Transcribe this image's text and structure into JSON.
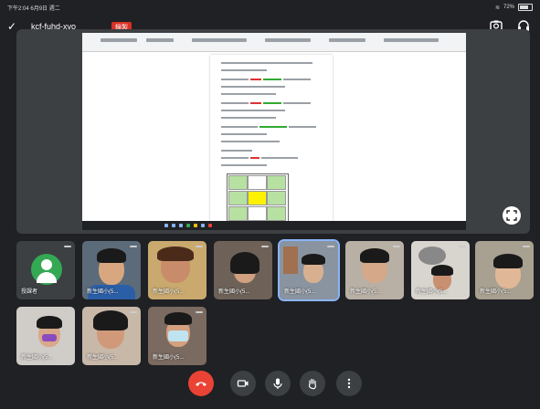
{
  "status_bar": {
    "time": "下午2:04",
    "date": "6月9日 週二",
    "battery": "72%"
  },
  "meeting": {
    "title": "kcf-fuhd-xvo",
    "recording_badge": "錄製"
  },
  "participants": [
    {
      "name": "授課者",
      "kind": "avatar"
    },
    {
      "name": "新生國小(5...",
      "kind": "video"
    },
    {
      "name": "新生國小(5...",
      "kind": "video"
    },
    {
      "name": "新生國小(5...",
      "kind": "video"
    },
    {
      "name": "新生國小(5...",
      "kind": "video",
      "active": true
    },
    {
      "name": "新生國小(5...",
      "kind": "video"
    },
    {
      "name": "新生國小(5...",
      "kind": "video"
    },
    {
      "name": "新生國小(5...",
      "kind": "video"
    },
    {
      "name": "新生國小(5...",
      "kind": "video"
    },
    {
      "name": "新生國小(5...",
      "kind": "video"
    },
    {
      "name": "新生國小(5...",
      "kind": "video"
    }
  ],
  "icons": {
    "back": "chevron-icon",
    "camera_switch": "camera-icon",
    "audio_output": "headphones-icon",
    "fullscreen": "fullscreen-icon",
    "end_call": "end-call-icon",
    "video": "video-icon",
    "mic": "mic-icon",
    "raise_hand": "hand-icon",
    "more": "more-vert-icon"
  },
  "colors": {
    "background": "#202124",
    "end_call": "#ea4335",
    "avatar": "#34a853",
    "active_border": "#8ab4f8"
  }
}
